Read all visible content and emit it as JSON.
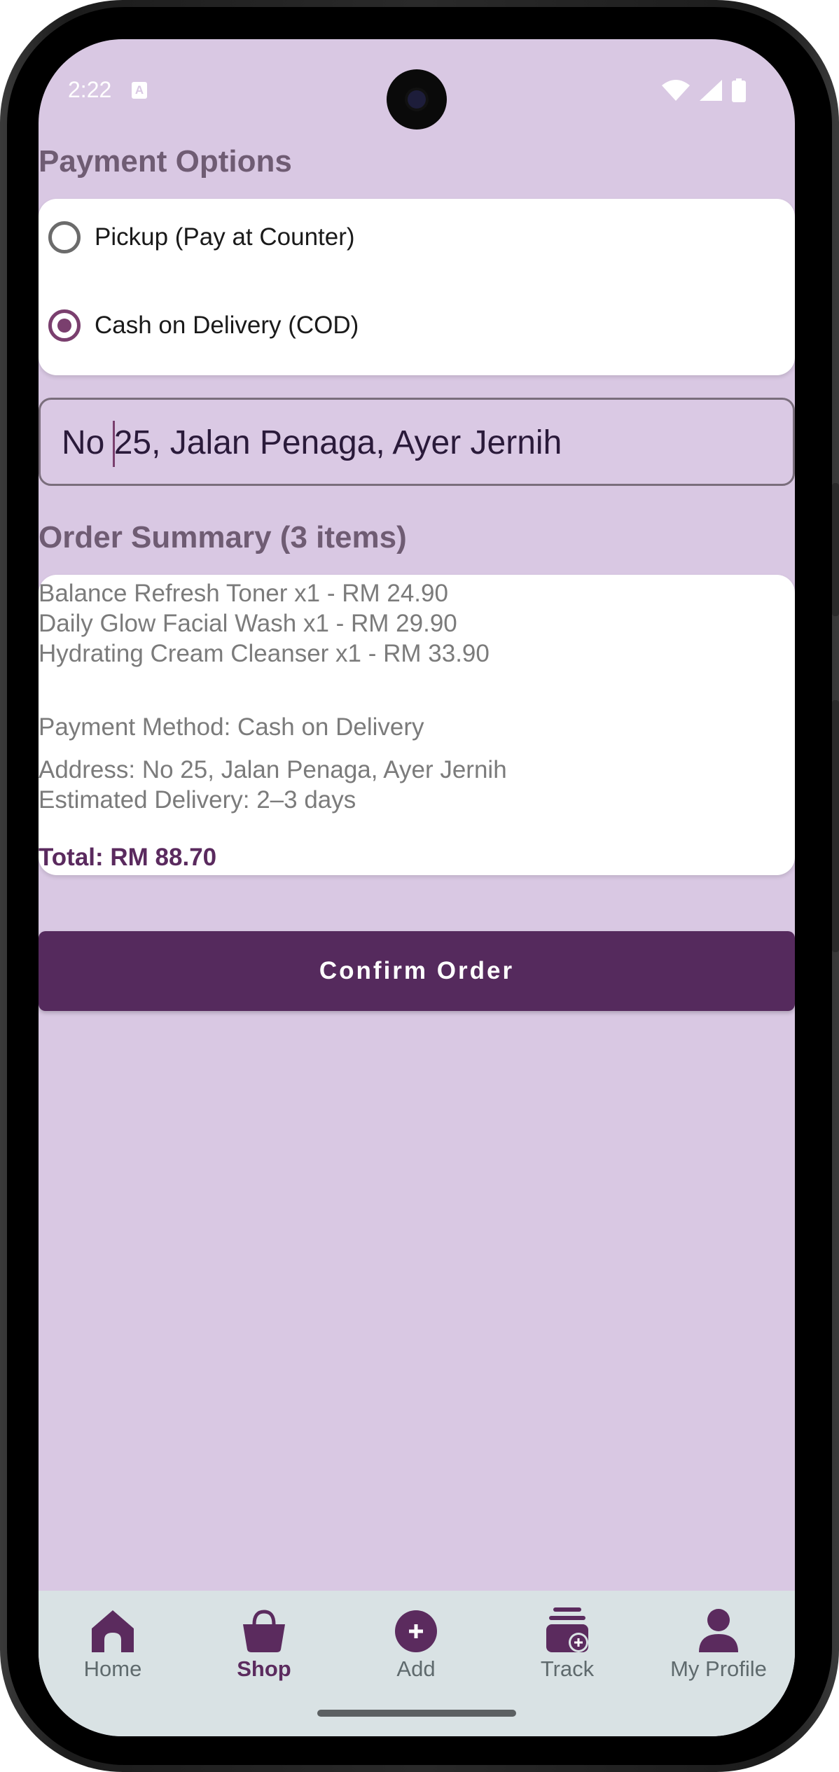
{
  "status_bar": {
    "time": "2:22",
    "notification_icon": "A"
  },
  "payment": {
    "title": "Payment Options",
    "options": [
      {
        "label": "Pickup (Pay at Counter)",
        "selected": false
      },
      {
        "label": "Cash on Delivery (COD)",
        "selected": true
      }
    ]
  },
  "address": {
    "value": "No 25, Jalan Penaga, Ayer Jernih"
  },
  "summary": {
    "title": "Order Summary (3 items)",
    "items": [
      "Balance Refresh Toner x1 - RM 24.90",
      "Daily Glow Facial Wash x1 - RM 29.90",
      "Hydrating Cream Cleanser x1 - RM 33.90"
    ],
    "payment_method": "Payment Method: Cash on Delivery",
    "address": "Address: No 25, Jalan Penaga, Ayer Jernih",
    "delivery": "Estimated Delivery: 2–3 days",
    "total": "Total: RM 88.70"
  },
  "confirm_label": "Confirm Order",
  "nav": {
    "items": [
      {
        "label": "Home",
        "icon": "home-icon",
        "active": false
      },
      {
        "label": "Shop",
        "icon": "basket-icon",
        "active": true
      },
      {
        "label": "Add",
        "icon": "add-circle-icon",
        "active": false
      },
      {
        "label": "Track",
        "icon": "track-icon",
        "active": false
      },
      {
        "label": "My Profile",
        "icon": "person-icon",
        "active": false
      }
    ]
  },
  "colors": {
    "background": "#d9c8e3",
    "accent": "#552a5d",
    "radio_selected": "#7a3f6e",
    "navbar": "#d9e2e4"
  }
}
